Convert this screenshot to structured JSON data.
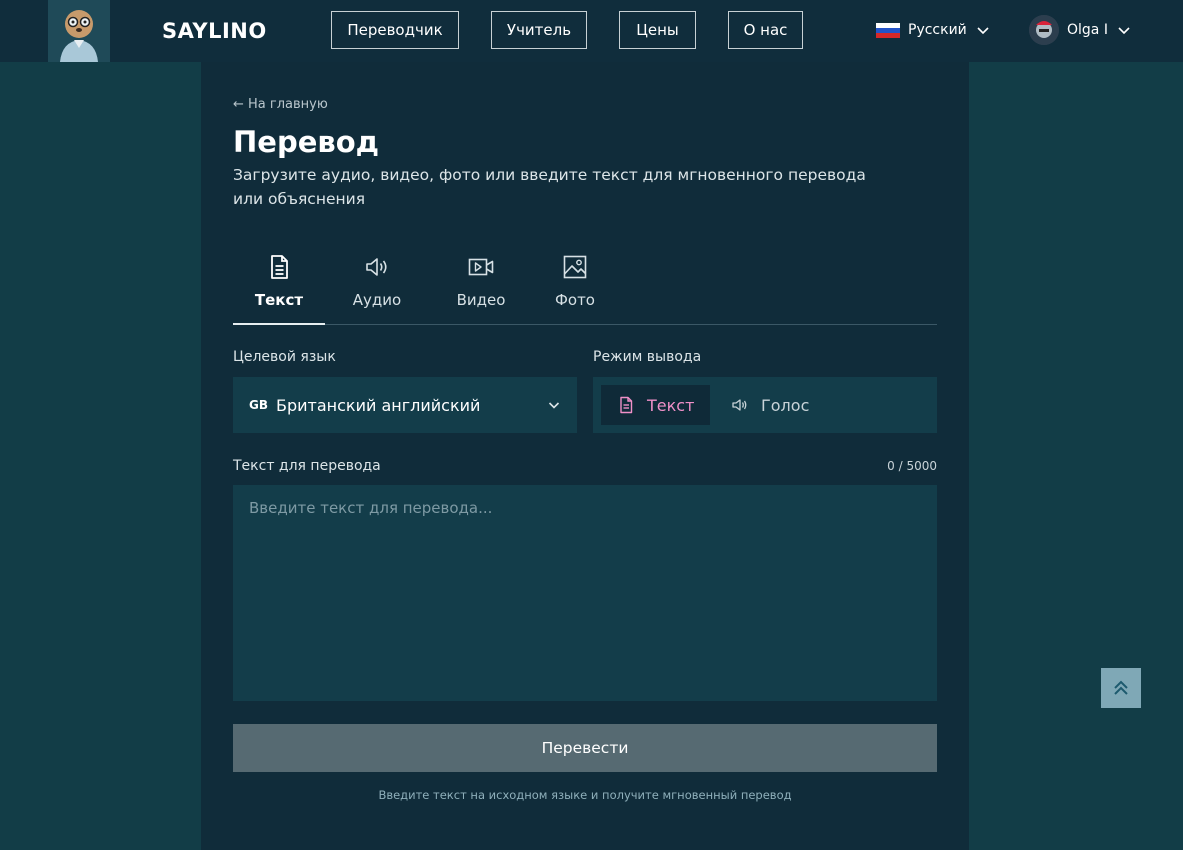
{
  "header": {
    "brand": "SAYLINO",
    "nav": [
      {
        "label": "Переводчик"
      },
      {
        "label": "Учитель"
      },
      {
        "label": "Цены"
      },
      {
        "label": "О нас"
      }
    ],
    "language": "Русский",
    "user_name": "Olga I"
  },
  "page": {
    "back_label": "← На главную",
    "title": "Перевод",
    "subtitle": "Загрузите аудио, видео, фото или введите текст для мгновенного перевода или объяснения"
  },
  "tabs": [
    {
      "label": "Текст",
      "icon": "document-icon",
      "active": true
    },
    {
      "label": "Аудио",
      "icon": "speaker-icon",
      "active": false
    },
    {
      "label": "Видео",
      "icon": "video-icon",
      "active": false
    },
    {
      "label": "Фото",
      "icon": "image-icon",
      "active": false
    }
  ],
  "form": {
    "target_language_label": "Целевой язык",
    "target_language_code": "GB",
    "target_language_value": "Британский английский",
    "output_mode_label": "Режим вывода",
    "output_mode_text": "Текст",
    "output_mode_voice": "Голос",
    "text_label": "Текст для перевода",
    "counter": "0 / 5000",
    "text_value": "",
    "text_placeholder": "Введите текст для перевода...",
    "translate_button": "Перевести",
    "hint": "Введите текст на исходном языке и получите мгновенный перевод"
  },
  "colors": {
    "page_bg": "#123d47",
    "panel_bg": "#102c3a",
    "header_bg": "#102d3c",
    "accent": "#f090c8",
    "button_bg": "#566a72"
  }
}
